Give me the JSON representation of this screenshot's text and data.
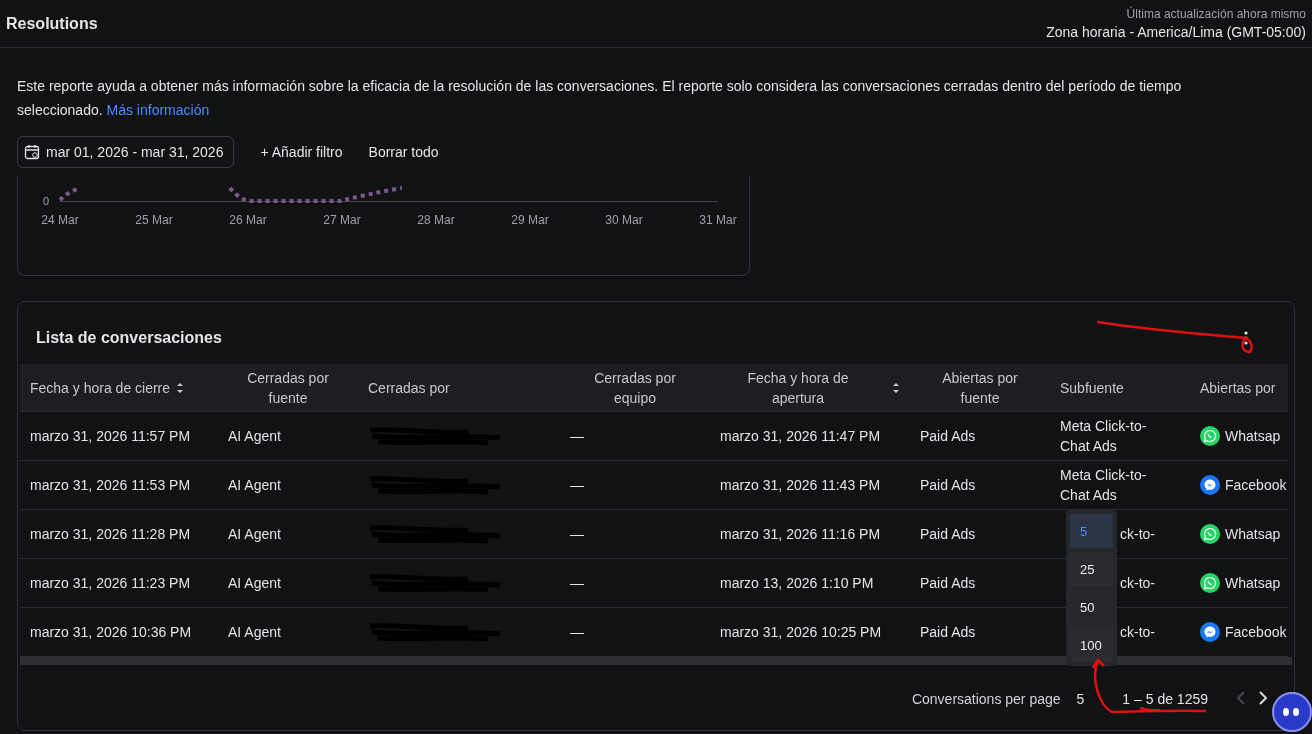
{
  "header": {
    "title": "Resolutions",
    "last_update": "Última actualización ahora mismo",
    "timezone": "Zona horaria - America/Lima (GMT-05:00)"
  },
  "description": {
    "text": "Este reporte ayuda a obtener más información sobre la eficacia de la resolución de las conversaciones. El reporte solo considera las conversaciones cerradas dentro del período de tiempo seleccionado.",
    "link": "Más información"
  },
  "filters": {
    "date_range": "mar 01, 2026 - mar 31, 2026",
    "add_filter": "+ Añadir filtro",
    "clear_all": "Borrar todo"
  },
  "chart": {
    "y_tick": "0",
    "x_labels": [
      "24 Mar",
      "25 Mar",
      "26 Mar",
      "27 Mar",
      "28 Mar",
      "29 Mar",
      "30 Mar",
      "31 Mar"
    ]
  },
  "table": {
    "title": "Lista de conversaciones",
    "columns": [
      {
        "label": "Fecha y hora de cierre",
        "kind": "sortable"
      },
      {
        "label": "Cerradas por fuente",
        "kind": "plain"
      },
      {
        "label": "Cerradas por",
        "kind": "plain"
      },
      {
        "label": "Cerradas por equipo",
        "kind": "plain"
      },
      {
        "label": "Fecha y hora de apertura",
        "kind": "sortable"
      },
      {
        "label": "Abiertas por fuente",
        "kind": "plain"
      },
      {
        "label": "Subfuente",
        "kind": "plain"
      },
      {
        "label": "Abiertas por",
        "kind": "plain"
      }
    ],
    "rows": [
      {
        "closed_at": "marzo 31, 2026 11:57 PM",
        "closed_source": "AI Agent",
        "team": "—",
        "opened_at": "marzo 31, 2026 11:47 PM",
        "opened_source": "Paid Ads",
        "subsource": "Meta Click-to-Chat Ads",
        "subsource_covered": false,
        "channel": {
          "kind": "whatsapp",
          "label": "Whatsap"
        }
      },
      {
        "closed_at": "marzo 31, 2026 11:53 PM",
        "closed_source": "AI Agent",
        "team": "—",
        "opened_at": "marzo 31, 2026 11:43 PM",
        "opened_source": "Paid Ads",
        "subsource": "Meta Click-to-Chat Ads",
        "subsource_covered": false,
        "channel": {
          "kind": "messenger",
          "label": "Facebook"
        }
      },
      {
        "closed_at": "marzo 31, 2026 11:28 PM",
        "closed_source": "AI Agent",
        "team": "—",
        "opened_at": "marzo 31, 2026 11:16 PM",
        "opened_source": "Paid Ads",
        "subsource": "ck-to-",
        "subsource_covered": true,
        "channel": {
          "kind": "whatsapp",
          "label": "Whatsap"
        }
      },
      {
        "closed_at": "marzo 31, 2026 11:23 PM",
        "closed_source": "AI Agent",
        "team": "—",
        "opened_at": "marzo 13, 2026 1:10 PM",
        "opened_source": "Paid Ads",
        "subsource": "ck-to-",
        "subsource_covered": true,
        "channel": {
          "kind": "whatsapp",
          "label": "Whatsap"
        }
      },
      {
        "closed_at": "marzo 31, 2026 10:36 PM",
        "closed_source": "AI Agent",
        "team": "—",
        "opened_at": "marzo 31, 2026 10:25 PM",
        "opened_source": "Paid Ads",
        "subsource": "ck-to-",
        "subsource_covered": true,
        "channel": {
          "kind": "messenger",
          "label": "Facebook"
        }
      }
    ]
  },
  "page_size_menu": [
    {
      "label": "5",
      "selected": true
    },
    {
      "label": "25",
      "selected": false
    },
    {
      "label": "50",
      "selected": false
    },
    {
      "label": "100",
      "selected": false
    }
  ],
  "pagination": {
    "label": "Conversations per page",
    "page_size": "5",
    "range": "1 – 5 de 1259",
    "prev_disabled": true
  }
}
